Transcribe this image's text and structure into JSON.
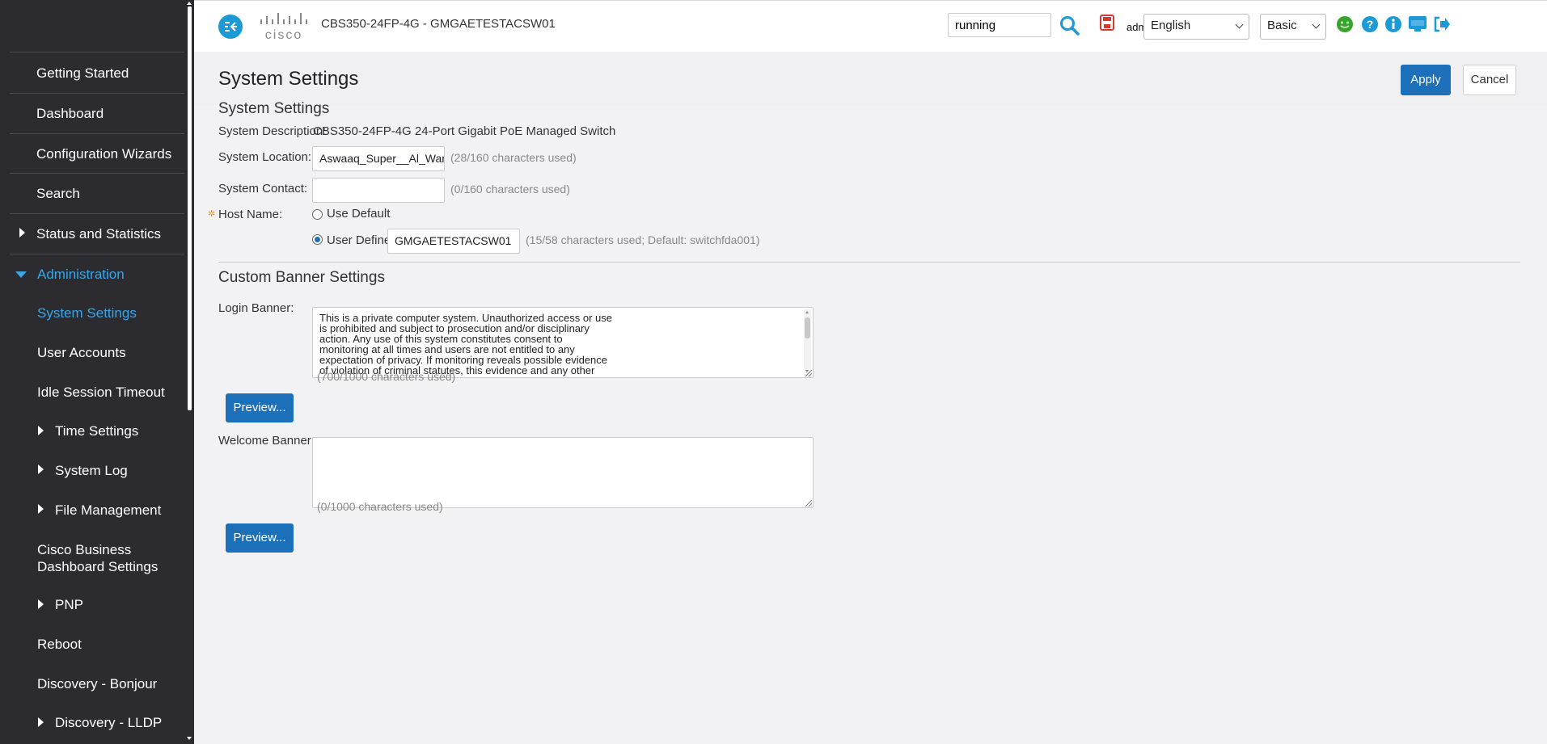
{
  "header": {
    "brand": "cisco",
    "device_title": "CBS350-24FP-4G - GMGAETESTACSW01",
    "search_value": "running",
    "user": "admin",
    "language": "English",
    "mode": "Basic",
    "brand_color": "#1b9ad6"
  },
  "sidebar": {
    "items": [
      {
        "label": "Getting Started"
      },
      {
        "label": "Dashboard"
      },
      {
        "label": "Configuration Wizards"
      },
      {
        "label": "Search"
      },
      {
        "label": "Status and Statistics"
      },
      {
        "label": "Administration"
      },
      {
        "label": "System Settings"
      },
      {
        "label": "User Accounts"
      },
      {
        "label": "Idle Session Timeout"
      },
      {
        "label": "Time Settings"
      },
      {
        "label": "System Log"
      },
      {
        "label": "File Management"
      },
      {
        "label": "Cisco Business"
      },
      {
        "label": "Dashboard Settings"
      },
      {
        "label": "PNP"
      },
      {
        "label": "Reboot"
      },
      {
        "label": "Discovery - Bonjour"
      },
      {
        "label": "Discovery - LLDP"
      }
    ]
  },
  "page": {
    "title": "System Settings",
    "apply_label": "Apply",
    "cancel_label": "Cancel"
  },
  "system": {
    "section_title": "System Settings",
    "description_label": "System Description:",
    "description_value": "CBS350-24FP-4G 24-Port Gigabit PoE Managed Switch",
    "location_label": "System Location:",
    "location_value": "Aswaaq_Super__Al_Warqaa",
    "location_hint": "(28/160 characters used)",
    "contact_label": "System Contact:",
    "contact_value": "",
    "contact_hint": "(0/160 characters used)",
    "hostname_label": "Host Name:",
    "use_default_label": "Use Default",
    "user_defined_label": "User Defined",
    "hostname_value": "GMGAETESTACSW01",
    "hostname_hint": "(15/58 characters used; Default: switchfda001)"
  },
  "banner": {
    "section_title": "Custom Banner Settings",
    "login_label": "Login Banner:",
    "login_text": "This is a private computer system. Unauthorized access or use\nis prohibited and subject to prosecution and/or disciplinary\naction. Any use of this system constitutes consent to\nmonitoring at all times and users are not entitled to any\nexpectation of privacy. If monitoring reveals possible evidence\nof violation of criminal statutes, this evidence and any other",
    "login_hint": "(700/1000 characters used)",
    "welcome_label": "Welcome Banner:",
    "welcome_text": "",
    "welcome_hint": "(0/1000 characters used)",
    "preview_label": "Preview..."
  }
}
